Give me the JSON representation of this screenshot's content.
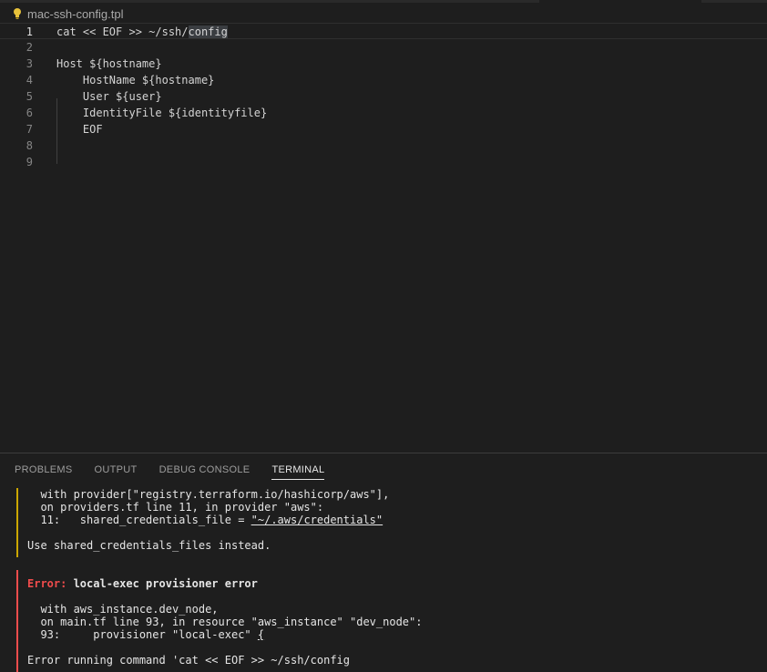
{
  "editor": {
    "file_name": "mac-ssh-config.tpl",
    "lines": [
      {
        "num": "1",
        "text": "cat << EOF >> ~/ssh/config"
      },
      {
        "num": "2",
        "text": ""
      },
      {
        "num": "3",
        "text": "Host ${hostname}"
      },
      {
        "num": "4",
        "text": "    HostName ${hostname}"
      },
      {
        "num": "5",
        "text": "    User ${user}"
      },
      {
        "num": "6",
        "text": "    IdentityFile ${identityfile}"
      },
      {
        "num": "7",
        "text": "    EOF"
      },
      {
        "num": "8",
        "text": ""
      },
      {
        "num": "9",
        "text": ""
      }
    ],
    "line1_prefix": "cat << EOF >> ~/ssh/",
    "line1_selected": "config"
  },
  "panel": {
    "tabs": [
      "PROBLEMS",
      "OUTPUT",
      "DEBUG CONSOLE",
      "TERMINAL"
    ],
    "active_tab": "TERMINAL"
  },
  "terminal": {
    "warn1": "  with provider[\"registry.terraform.io/hashicorp/aws\"],",
    "warn2": "  on providers.tf line 11, in provider \"aws\":",
    "warn3_prefix": "  11:   shared_credentials_file = ",
    "warn3_value": "\"~/.aws/credentials\"",
    "warn4": "Use shared_credentials_files instead.",
    "error_label": "Error:",
    "error_title": " local-exec provisioner error",
    "err1": "  with aws_instance.dev_node,",
    "err2": "  on main.tf line 93, in resource \"aws_instance\" \"dev_node\":",
    "err3_prefix": "  93:     provisioner \"local-exec\" ",
    "err3_brace": "{",
    "err4": "Error running command 'cat << EOF >> ~/ssh/config"
  },
  "colors": {
    "background": "#1e1e1e",
    "warning_bar": "#cca700",
    "error_bar": "#f14c4c",
    "error_text": "#f14c4c"
  }
}
